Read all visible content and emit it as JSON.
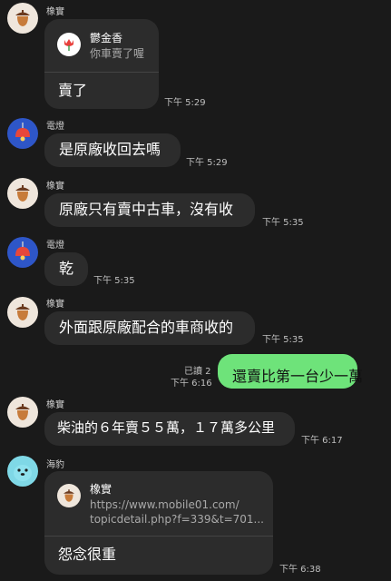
{
  "messages": [
    {
      "name": "橡實",
      "reply_name": "鬱金香",
      "reply_text": "你車賣了喔",
      "text": "賣了",
      "time": "下午 5:29"
    },
    {
      "name": "電燈",
      "text": "是原廠收回去嗎",
      "time": "下午 5:29"
    },
    {
      "name": "橡實",
      "text": "原廠只有賣中古車，沒有收",
      "time": "下午 5:35"
    },
    {
      "name": "電燈",
      "text": "乾",
      "time": "下午 5:35"
    },
    {
      "name": "橡實",
      "text": "外面跟原廠配合的車商收的",
      "time": "下午 5:35"
    },
    {
      "read": "已讀 2",
      "time": "下午 6:16",
      "text": "還賣比第一台少一萬"
    },
    {
      "name": "橡實",
      "text": "柴油的６年賣５５萬，１７萬多公里",
      "time": "下午 6:17"
    },
    {
      "name": "海豹",
      "reply_name": "橡實",
      "reply_url1": "https://www.mobile01.com/",
      "reply_url2": "topicdetail.php?f=339&t=701...",
      "text": "怨念很重",
      "time": "下午 6:38"
    }
  ],
  "icons": {
    "acorn": "acorn-icon",
    "lamp": "lamp-icon",
    "seal": "seal-icon",
    "tulip": "tulip-icon"
  },
  "colors": {
    "background": "#1a1a1a",
    "bubble": "#2c2c2c",
    "sent_bubble": "#6ee37a"
  }
}
